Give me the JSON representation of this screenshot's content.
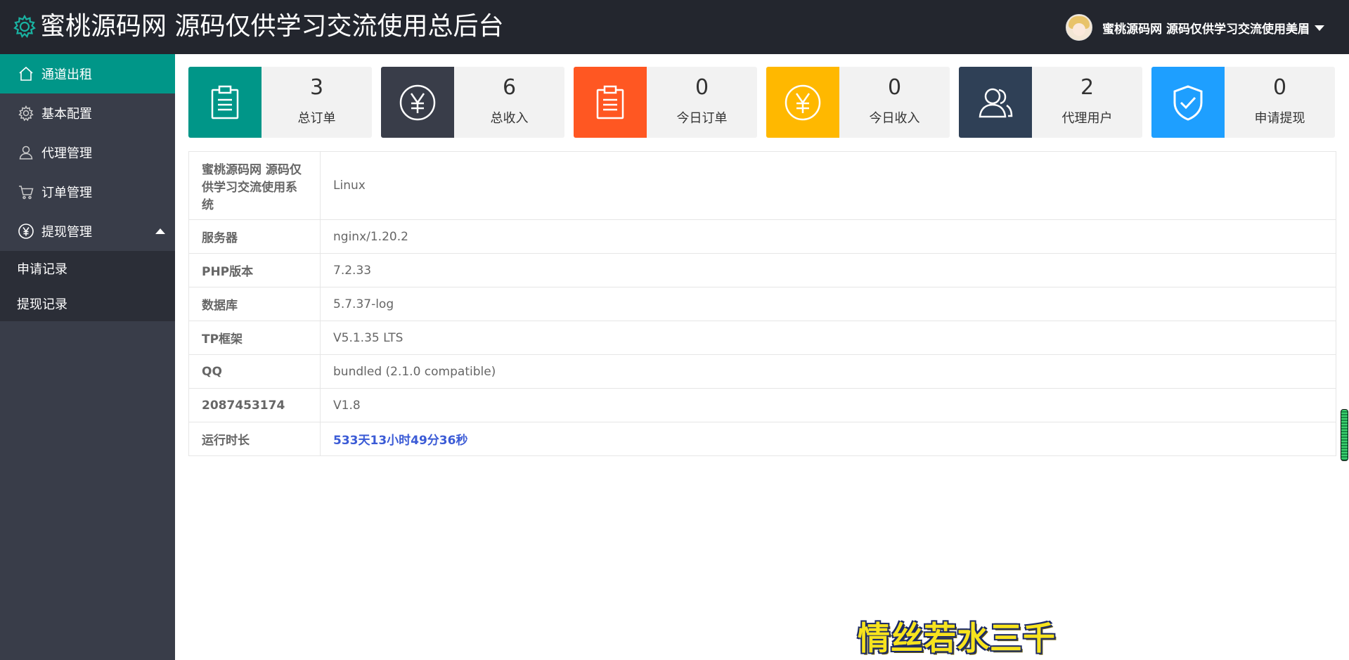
{
  "header": {
    "title": "蜜桃源码网 源码仅供学习交流使用总后台",
    "user_name": "蜜桃源码网 源码仅供学习交流使用美眉"
  },
  "sidebar": {
    "items": [
      {
        "label": "通道出租",
        "icon": "home-icon"
      },
      {
        "label": "基本配置",
        "icon": "gear-icon"
      },
      {
        "label": "代理管理",
        "icon": "user-icon"
      },
      {
        "label": "订单管理",
        "icon": "cart-icon"
      },
      {
        "label": "提现管理",
        "icon": "yuan-icon"
      }
    ],
    "subitems": [
      {
        "label": "申请记录"
      },
      {
        "label": "提现记录"
      }
    ]
  },
  "stats": [
    {
      "value": "3",
      "label": "总订单",
      "color": "#009688",
      "icon": "clipboard-icon"
    },
    {
      "value": "6",
      "label": "总收入",
      "color": "#393d49",
      "icon": "yuan-circle-icon"
    },
    {
      "value": "0",
      "label": "今日订单",
      "color": "#ff5722",
      "icon": "clipboard-icon"
    },
    {
      "value": "0",
      "label": "今日收入",
      "color": "#ffb800",
      "icon": "yuan-circle-icon"
    },
    {
      "value": "2",
      "label": "代理用户",
      "color": "#2f4056",
      "icon": "users-icon"
    },
    {
      "value": "0",
      "label": "申请提现",
      "color": "#1e9fff",
      "icon": "shield-check-icon"
    }
  ],
  "info": [
    {
      "key": "蜜桃源码网 源码仅供学习交流使用系统",
      "value": "Linux"
    },
    {
      "key": "服务器",
      "value": "nginx/1.20.2"
    },
    {
      "key": "PHP版本",
      "value": "7.2.33"
    },
    {
      "key": "数据库",
      "value": "5.7.37-log"
    },
    {
      "key": "TP框架",
      "value": "V5.1.35 LTS"
    },
    {
      "key": "QQ",
      "value": "bundled (2.1.0 compatible)"
    },
    {
      "key": "2087453174",
      "value": "V1.8"
    },
    {
      "key": "运行时长",
      "value": "533天13小时49分36秒"
    }
  ],
  "watermark": "情丝若水三千"
}
